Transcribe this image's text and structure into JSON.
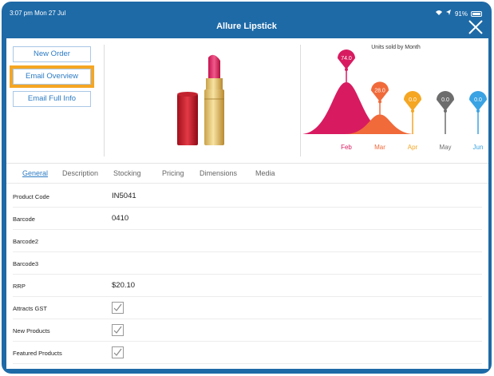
{
  "status_bar": {
    "time_date": "3:07 pm  Mon 27 Jul",
    "battery": "91%"
  },
  "header": {
    "title": "Allure Lipstick"
  },
  "actions": {
    "new_order": "New Order",
    "email_overview": "Email Overview",
    "email_full_info": "Email Full Info"
  },
  "chart_data": {
    "type": "area",
    "title": "Units sold by Month",
    "categories": [
      "Feb",
      "Mar",
      "Apr",
      "May",
      "Jun"
    ],
    "values": [
      74.0,
      28.0,
      0.0,
      0.0,
      0.0
    ],
    "labels": [
      "74.0",
      "28.0",
      "0.0",
      "0.0",
      "0.0"
    ],
    "colors": [
      "#d81b60",
      "#f06a3a",
      "#f5a623",
      "#6d6d6d",
      "#3aa3e3"
    ],
    "xlabel": "",
    "ylabel": ""
  },
  "tabs": [
    "General",
    "Description",
    "Stocking",
    "Pricing",
    "Dimensions",
    "Media"
  ],
  "fields": [
    {
      "label": "Product Code",
      "value": "IN5041"
    },
    {
      "label": "Barcode",
      "value": "0410"
    },
    {
      "label": "Barcode2",
      "value": ""
    },
    {
      "label": "Barcode3",
      "value": ""
    },
    {
      "label": "RRP",
      "value": "$20.10"
    },
    {
      "label": "Attracts GST",
      "checked": true
    },
    {
      "label": "New Products",
      "checked": true
    },
    {
      "label": "Featured Products",
      "checked": true
    }
  ]
}
